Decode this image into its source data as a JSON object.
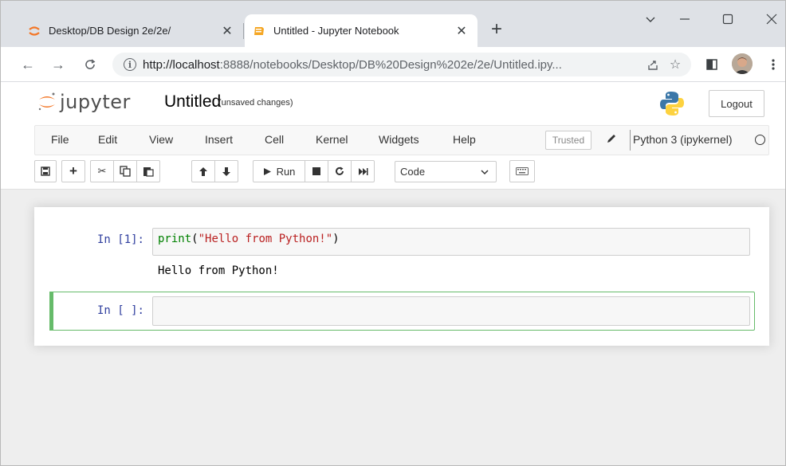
{
  "browser": {
    "tabs": [
      {
        "title": "Desktop/DB Design 2e/2e/",
        "favicon": "jupyter-icon",
        "active": false
      },
      {
        "title": "Untitled - Jupyter Notebook",
        "favicon": "notebook-icon",
        "active": true
      }
    ],
    "url_host": "http://localhost",
    "url_path": ":8888/notebooks/Desktop/DB%20Design%202e/2e/Untitled.ipy..."
  },
  "jupyter": {
    "logo_text": "jupyter",
    "notebook_name": "Untitled",
    "save_status": "(unsaved changes)",
    "logout_label": "Logout",
    "menu": [
      "File",
      "Edit",
      "View",
      "Insert",
      "Cell",
      "Kernel",
      "Widgets",
      "Help"
    ],
    "trusted_label": "Trusted",
    "kernel_name": "Python 3 (ipykernel)",
    "run_label": "Run",
    "cell_type": "Code"
  },
  "cells": [
    {
      "prompt": "In [1]:",
      "code_fn": "print",
      "code_open": "(",
      "code_str": "\"Hello from Python!\"",
      "code_close": ")",
      "output": "Hello from Python!"
    },
    {
      "prompt": "In [ ]:",
      "code": ""
    }
  ],
  "colors": {
    "accent_orange": "#f37626",
    "prompt_blue": "#303f9f",
    "selected_cell_green": "#66bb6a"
  }
}
